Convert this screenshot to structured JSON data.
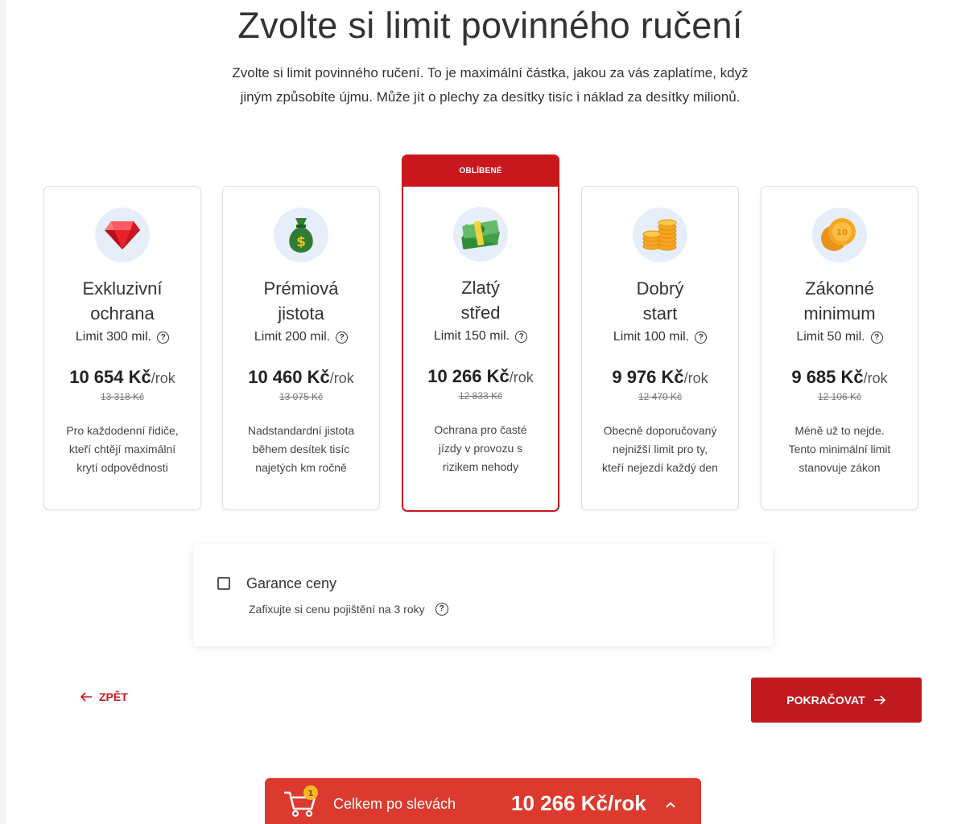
{
  "title": "Zvolte si limit povinného ručení",
  "subtitle_line1": "Zvolte si limit povinného ručení. To je maximální částka, jakou za vás zaplatíme, když",
  "subtitle_line2": "jiným způsobíte újmu. Může jít o plechy za desítky tisíc i náklad za desítky milionů.",
  "plans": [
    {
      "name_line1": "Exkluzivní",
      "name_line2": "ochrana",
      "limit": "Limit 300 mil.",
      "price": "10 654 Kč",
      "per": "/rok",
      "old_price": "13 318 Kč",
      "desc": [
        "Pro každodenní řidiče,",
        "kteří chtějí maximální",
        "krytí odpovědnosti"
      ],
      "icon": "diamond-icon"
    },
    {
      "name_line1": "Prémiová",
      "name_line2": "jistota",
      "limit": "Limit 200 mil.",
      "price": "10 460 Kč",
      "per": "/rok",
      "old_price": "13 075 Kč",
      "desc": [
        "Nadstandardní jistota",
        "během desítek tisíc",
        "najetých km ročně"
      ],
      "icon": "money-bag-icon"
    },
    {
      "badge": "OBLÍBENÉ",
      "name_line1": "Zlatý",
      "name_line2": "střed",
      "limit": "Limit 150 mil.",
      "price": "10 266 Kč",
      "per": "/rok",
      "old_price": "12 833 Kč",
      "desc": [
        "Ochrana pro časté",
        "jízdy v provozu s",
        "rizikem nehody"
      ],
      "icon": "cash-stack-icon"
    },
    {
      "name_line1": "Dobrý",
      "name_line2": "start",
      "limit": "Limit 100 mil.",
      "price": "9 976 Kč",
      "per": "/rok",
      "old_price": "12 470 Kč",
      "desc": [
        "Obecně doporučovaný",
        "nejnižší limit pro ty,",
        "kteří nejezdí každý den"
      ],
      "icon": "coin-stack-icon"
    },
    {
      "name_line1": "Zákonné",
      "name_line2": "minimum",
      "limit": "Limit 50 mil.",
      "price": "9 685 Kč",
      "per": "/rok",
      "old_price": "12 106 Kč",
      "desc": [
        "Méně už to nejde.",
        "Tento minimální limit",
        "stanovuje zákon"
      ],
      "icon": "coin-icon"
    }
  ],
  "guarantee": {
    "label": "Garance ceny",
    "desc": "Zafixujte si cenu pojištění na 3 roky",
    "checked": false
  },
  "nav": {
    "back": "ZPĚT",
    "continue": "POKRAČOVAT"
  },
  "cart": {
    "count": "1",
    "label": "Celkem po slevách",
    "total": "10 266 Kč/rok"
  },
  "colors": {
    "accent": "#c8181e",
    "cart_bar": "#dc3a2e",
    "icon_bg": "#e6eefa"
  }
}
